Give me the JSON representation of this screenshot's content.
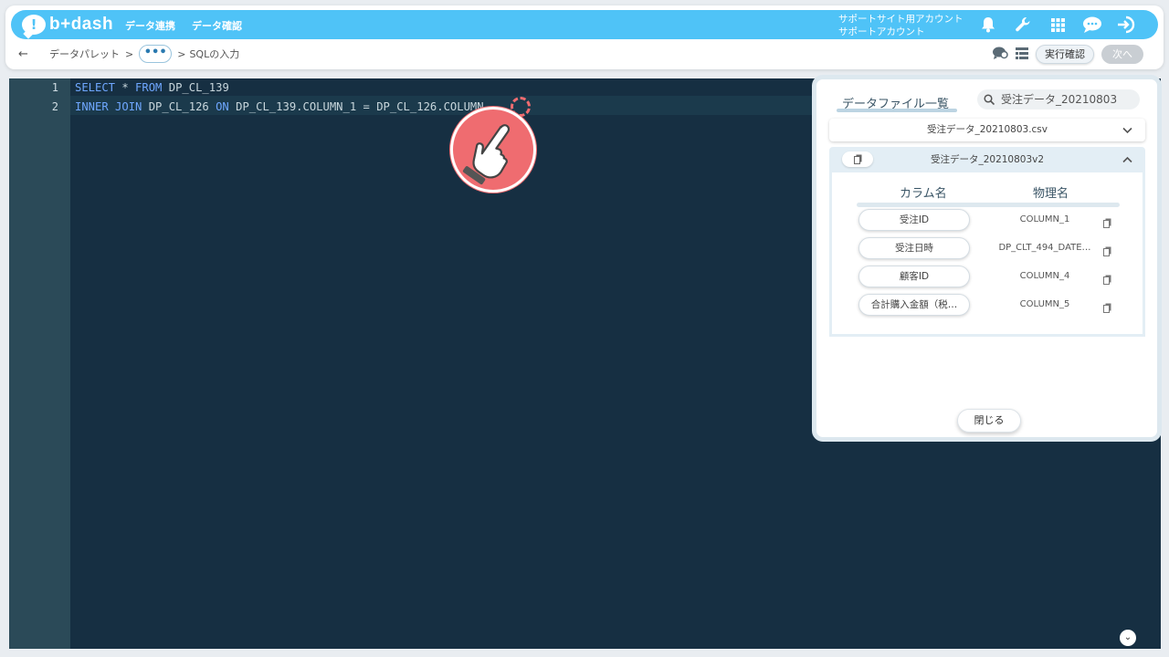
{
  "header": {
    "logo_text": "b+dash",
    "nav": [
      "データ連携",
      "データ確認"
    ],
    "account_line1": "サポートサイト用アカウント",
    "account_line2": "サポートアカウント",
    "icons": [
      "bell-icon",
      "wrench-icon",
      "grid-icon",
      "chat-icon",
      "logout-icon"
    ]
  },
  "breadcrumb": {
    "back_icon": "←",
    "first": "データパレット",
    "sep1": ">",
    "more": "•••",
    "sep2": ">",
    "current": "SQLの入力"
  },
  "toolbar": {
    "confirm_label": "実行確認",
    "next_label": "次へ"
  },
  "editor": {
    "line_numbers": [
      "1",
      "2"
    ],
    "lines": [
      [
        {
          "t": "SELECT",
          "kw": true
        },
        {
          "t": " * ",
          "kw": false
        },
        {
          "t": "FROM",
          "kw": true
        },
        {
          "t": " DP_CL_139",
          "kw": false
        }
      ],
      [
        {
          "t": "INNER JOIN",
          "kw": true
        },
        {
          "t": " DP_CL_126 ",
          "kw": false
        },
        {
          "t": "ON",
          "kw": true
        },
        {
          "t": " DP_CL_139.COLUMN_1 = DP_CL_126.COLUMN_",
          "kw": false
        }
      ]
    ]
  },
  "panel": {
    "title": "データファイル一覧",
    "search_value": "受注データ_20210803",
    "files": [
      "受注データ_20210803.csv",
      "受注データ_20210803v2"
    ],
    "col_header_name": "カラム名",
    "col_header_phys": "物理名",
    "columns": [
      {
        "name": "受注ID",
        "phys": "COLUMN_1"
      },
      {
        "name": "受注日時",
        "phys": "DP_CLT_494_DATE…"
      },
      {
        "name": "顧客ID",
        "phys": "COLUMN_4"
      },
      {
        "name": "合計購入金額（税…",
        "phys": "COLUMN_5"
      }
    ],
    "close_label": "閉じる"
  }
}
